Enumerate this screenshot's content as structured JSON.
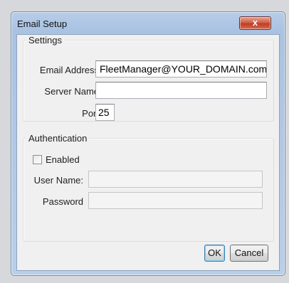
{
  "dialog": {
    "title": "Email Setup",
    "close_label": "x"
  },
  "settings": {
    "legend": "Settings",
    "email_label": "Email Address",
    "email_value": "FleetManager@YOUR_DOMAIN.com",
    "server_label": "Server Name",
    "server_value": "",
    "port_label": "Port",
    "port_value": "25"
  },
  "authentication": {
    "legend": "Authentication",
    "enabled_label": "Enabled",
    "enabled_checked": false,
    "username_label": "User Name:",
    "username_value": "",
    "password_label": "Password",
    "password_value": ""
  },
  "buttons": {
    "ok_label": "OK",
    "cancel_label": "Cancel"
  }
}
